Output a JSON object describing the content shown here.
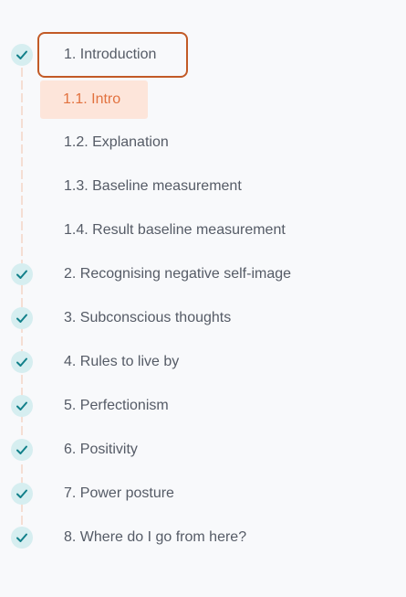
{
  "colors": {
    "check_bg": "#d6eef0",
    "check_mark": "#12808a",
    "active_border": "#c25a26",
    "active_sub_bg": "#fde5da",
    "active_sub_text": "#e2723f",
    "rail": "#f5ded3"
  },
  "chapters": [
    {
      "label": "1. Introduction",
      "completed": true,
      "status_icon": "check-icon",
      "subitems": [
        {
          "label": "1.1. Intro",
          "active": true
        },
        {
          "label": "1.2. Explanation"
        },
        {
          "label": "1.3. Baseline measurement"
        },
        {
          "label": "1.4. Result baseline measurement"
        }
      ]
    },
    {
      "label": "2. Recognising negative self-image",
      "completed": true,
      "status_icon": "check-icon"
    },
    {
      "label": "3. Subconscious thoughts",
      "completed": true,
      "status_icon": "check-icon"
    },
    {
      "label": "4. Rules to live by",
      "completed": true,
      "status_icon": "check-icon"
    },
    {
      "label": "5. Perfectionism",
      "completed": true,
      "status_icon": "check-icon"
    },
    {
      "label": "6. Positivity",
      "completed": true,
      "status_icon": "check-icon"
    },
    {
      "label": "7. Power posture",
      "completed": true,
      "status_icon": "check-icon"
    },
    {
      "label": "8. Where do I go from here?",
      "completed": true,
      "status_icon": "check-icon"
    }
  ]
}
